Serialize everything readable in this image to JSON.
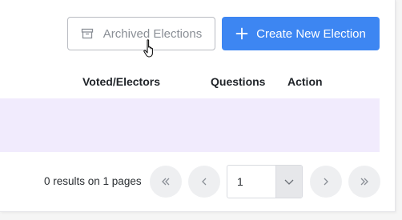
{
  "toolbar": {
    "archived_label": "Archived Elections",
    "create_label": "Create New Election"
  },
  "table": {
    "headers": [
      "Voted/Electors",
      "Questions",
      "Action"
    ]
  },
  "pagination": {
    "summary": "0 results on 1 pages",
    "page_select_value": "1"
  },
  "colors": {
    "primary": "#3d86f2",
    "row_highlight": "#f1ebfd"
  },
  "icons": {
    "archive": "archive-box-icon",
    "plus": "plus-icon",
    "cursor": "hand-pointer-cursor",
    "first": "double-chevron-left-icon",
    "prev": "chevron-left-icon",
    "next": "chevron-right-icon",
    "last": "double-chevron-right-icon",
    "dropdown": "chevron-down-icon"
  }
}
